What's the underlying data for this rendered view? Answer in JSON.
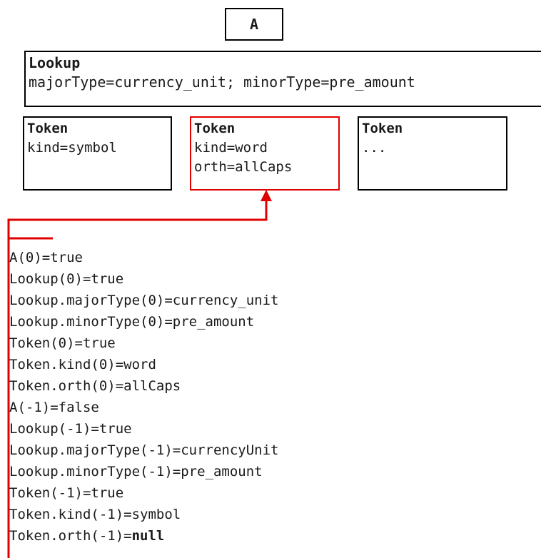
{
  "box_a": {
    "title": "A"
  },
  "lookup": {
    "title": "Lookup",
    "features": "majorType=currency_unit; minorType=pre_amount"
  },
  "tokens": [
    {
      "title": "Token",
      "lines": [
        "kind=symbol"
      ],
      "highlighted": false
    },
    {
      "title": "Token",
      "lines": [
        "kind=word",
        "orth=allCaps"
      ],
      "highlighted": true
    },
    {
      "title": "Token",
      "lines": [
        "..."
      ],
      "highlighted": false
    }
  ],
  "highlight_color": "#e00000",
  "feature_list": [
    {
      "lhs": "A(0)=",
      "rhs": "true"
    },
    {
      "lhs": "Lookup(0)=",
      "rhs": "true"
    },
    {
      "lhs": "Lookup.majorType(0)=",
      "rhs": "currency_unit"
    },
    {
      "lhs": "Lookup.minorType(0)=",
      "rhs": "pre_amount"
    },
    {
      "lhs": "Token(0)=",
      "rhs": "true"
    },
    {
      "lhs": "Token.kind(0)=",
      "rhs": "word"
    },
    {
      "lhs": "Token.orth(0)=",
      "rhs": "allCaps"
    },
    {
      "lhs": "A(-1)=",
      "rhs": "false"
    },
    {
      "lhs": "Lookup(-1)=",
      "rhs": "true"
    },
    {
      "lhs": "Lookup.majorType(-1)=",
      "rhs": "currencyUnit"
    },
    {
      "lhs": "Lookup.minorType(-1)=",
      "rhs": "pre_amount"
    },
    {
      "lhs": "Token(-1)=",
      "rhs": "true"
    },
    {
      "lhs": "Token.kind(-1)=",
      "rhs": "symbol"
    },
    {
      "lhs": "Token.orth(-1)=",
      "rhs": "null",
      "bold": true
    }
  ]
}
